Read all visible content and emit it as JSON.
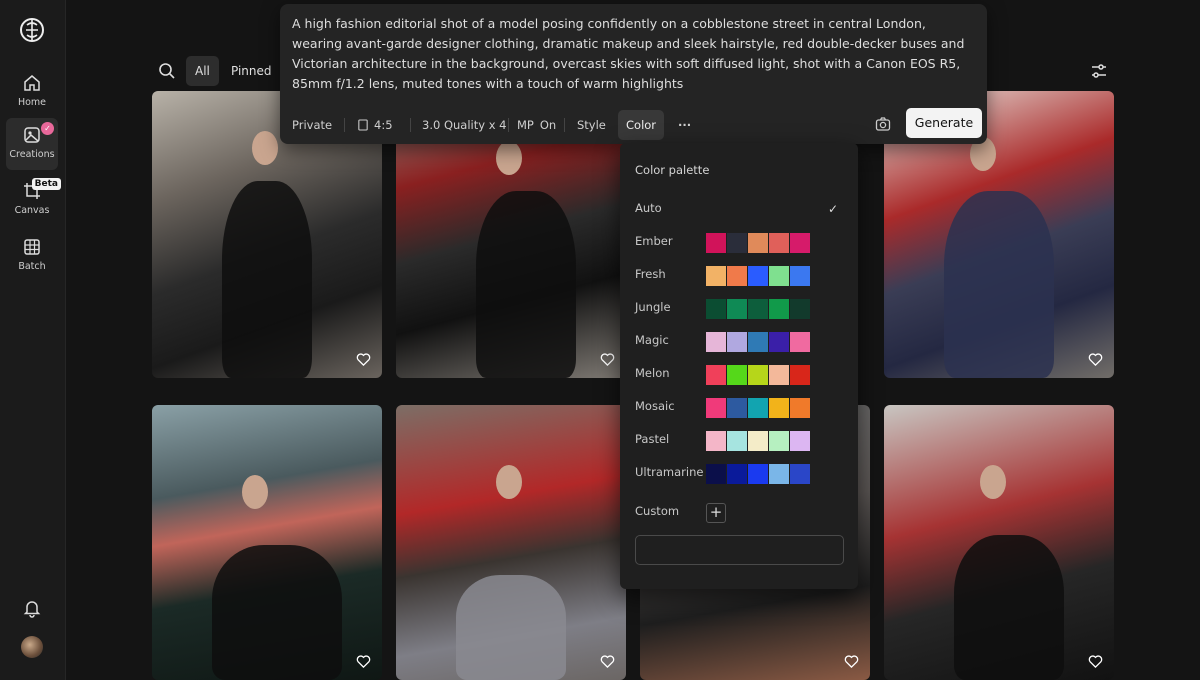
{
  "sidebar": {
    "items": [
      {
        "label": "Home",
        "icon": "home-icon"
      },
      {
        "label": "Creations",
        "icon": "creations-icon",
        "active": true
      },
      {
        "label": "Canvas",
        "icon": "canvas-icon",
        "badge": "Beta"
      },
      {
        "label": "Batch",
        "icon": "batch-icon"
      }
    ]
  },
  "filters": {
    "all_label": "All",
    "pinned_label": "Pinned"
  },
  "prompt": {
    "text": "A high fashion editorial shot of a model posing confidently on a cobblestone street in central London, wearing avant-garde designer clothing, dramatic makeup and sleek hairstyle, red double-decker buses and Victorian architecture in the background, overcast skies with soft diffused light, shot with a Canon EOS R5, 85mm f/1.2 lens, muted tones with a touch of warm highlights",
    "toolbar": {
      "privacy": "Private",
      "ratio": "4:5",
      "quality": "3.0 Quality x 4",
      "mp_label": "MP",
      "mp_value": "On",
      "style": "Style",
      "color": "Color",
      "more": "···",
      "generate": "Generate"
    }
  },
  "color_palette": {
    "title": "Color palette",
    "options": [
      {
        "name": "Auto",
        "selected": true,
        "colors": []
      },
      {
        "name": "Ember",
        "colors": [
          "#d1135a",
          "#2a2d3a",
          "#e08a5a",
          "#e0605a",
          "#d61b6a"
        ]
      },
      {
        "name": "Fresh",
        "colors": [
          "#f2b266",
          "#f07a4a",
          "#2a5cff",
          "#7fe08f",
          "#3b78f0"
        ]
      },
      {
        "name": "Jungle",
        "colors": [
          "#0b4d32",
          "#0f8a55",
          "#0d5e3c",
          "#119a4a",
          "#123a2c"
        ]
      },
      {
        "name": "Magic",
        "colors": [
          "#e6b6d8",
          "#b0a8e0",
          "#2f7ab5",
          "#3a1fa8",
          "#f06aa0"
        ]
      },
      {
        "name": "Melon",
        "colors": [
          "#f0405a",
          "#55d81a",
          "#b6d61a",
          "#f3b89a",
          "#d8261a"
        ]
      },
      {
        "name": "Mosaic",
        "colors": [
          "#f03a7a",
          "#2d5aa0",
          "#12a4b0",
          "#f2b31a",
          "#f07a2a"
        ]
      },
      {
        "name": "Pastel",
        "colors": [
          "#f4b6c8",
          "#a6e4e0",
          "#f4ecc8",
          "#b6f0c0",
          "#dcb6f2"
        ]
      },
      {
        "name": "Ultramarine",
        "colors": [
          "#0b0f4a",
          "#0a1a9a",
          "#1a3af0",
          "#7ab6e8",
          "#2a46c8"
        ]
      }
    ],
    "custom_label": "Custom",
    "custom_plus": "+"
  }
}
